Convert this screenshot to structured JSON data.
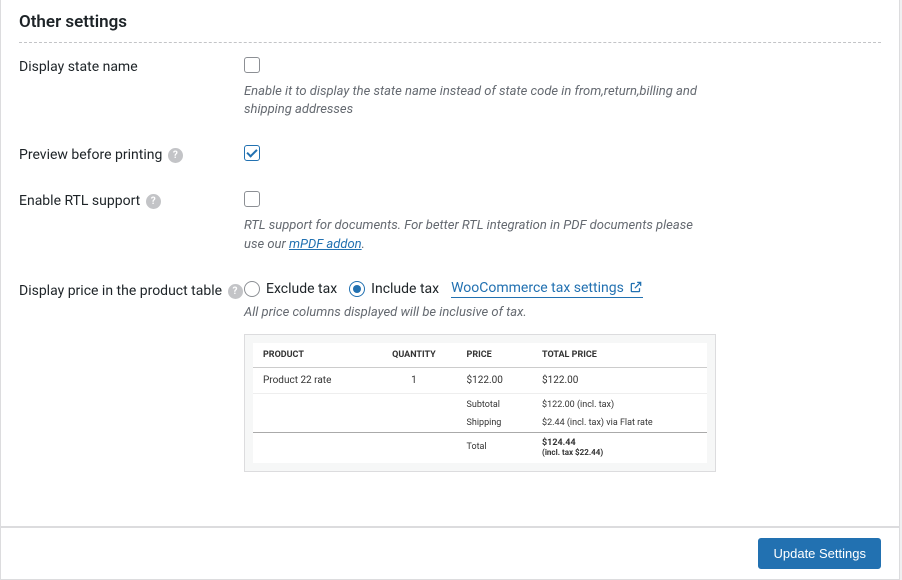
{
  "section_title": "Other settings",
  "rows": {
    "display_state_name": {
      "label": "Display state name",
      "checked": false,
      "desc": "Enable it to display the state name instead of state code in from,return,billing and shipping addresses"
    },
    "preview_before_printing": {
      "label": "Preview before printing",
      "checked": true
    },
    "enable_rtl": {
      "label": "Enable RTL support",
      "checked": false,
      "desc_prefix": "RTL support for documents. For better RTL integration in PDF documents please use our ",
      "desc_link_text": "mPDF addon",
      "desc_suffix": "."
    },
    "display_price": {
      "label": "Display price in the product table",
      "radio_selected": "include",
      "option_exclude": "Exclude tax",
      "option_include": "Include tax",
      "link_text": "WooCommerce tax settings",
      "desc": "All price columns displayed will be inclusive of tax."
    }
  },
  "preview_table": {
    "headers": {
      "product": "PRODUCT",
      "quantity": "QUANTITY",
      "price": "PRICE",
      "total_price": "TOTAL PRICE"
    },
    "row": {
      "product": "Product 22 rate",
      "quantity": "1",
      "price": "$122.00",
      "total": "$122.00"
    },
    "summary": {
      "subtotal_label": "Subtotal",
      "subtotal_val": "$122.00 (incl. tax)",
      "shipping_label": "Shipping",
      "shipping_val": "$2.44 (incl. tax) via Flat rate",
      "total_label": "Total",
      "total_val": "$124.44",
      "total_sub": "(incl. tax $22.44)"
    }
  },
  "footer": {
    "button": "Update Settings"
  }
}
